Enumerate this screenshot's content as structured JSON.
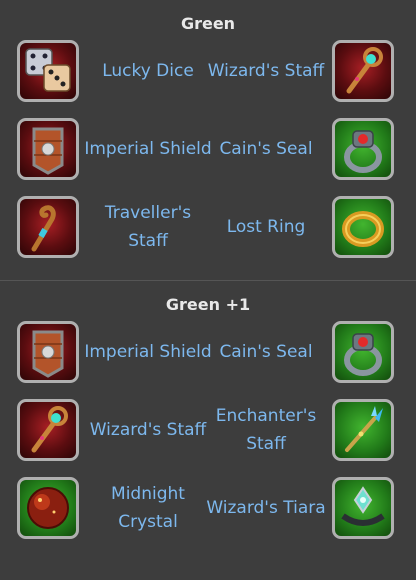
{
  "sections": [
    {
      "title": "Green",
      "rows": [
        {
          "left": {
            "name": "Lucky Dice",
            "icon": "dice-icon",
            "frame": "red"
          },
          "right": {
            "name": "Wizard's Staff",
            "icon": "wizard-staff-icon",
            "frame": "red"
          }
        },
        {
          "left": {
            "name": "Imperial Shield",
            "icon": "shield-icon",
            "frame": "red"
          },
          "right": {
            "name": "Cain's Seal",
            "icon": "ring-icon",
            "frame": "green"
          }
        },
        {
          "left": {
            "name": "Traveller's Staff",
            "icon": "traveller-staff-icon",
            "frame": "red"
          },
          "right": {
            "name": "Lost Ring",
            "icon": "gold-ring-icon",
            "frame": "green"
          }
        }
      ]
    },
    {
      "title": "Green +1",
      "rows": [
        {
          "left": {
            "name": "Imperial Shield",
            "icon": "shield-icon",
            "frame": "red"
          },
          "right": {
            "name": "Cain's Seal",
            "icon": "ring-icon",
            "frame": "green"
          }
        },
        {
          "left": {
            "name": "Wizard's Staff",
            "icon": "wizard-staff-icon",
            "frame": "red"
          },
          "right": {
            "name": "Enchanter's Staff",
            "icon": "enchanter-staff-icon",
            "frame": "green"
          }
        },
        {
          "left": {
            "name": "Midnight Crystal",
            "icon": "crystal-orb-icon",
            "frame": "green"
          },
          "right": {
            "name": "Wizard's Tiara",
            "icon": "tiara-icon",
            "frame": "green"
          }
        }
      ]
    }
  ],
  "colors": {
    "background": "#3d3d3d",
    "title": "#e9e9e9",
    "item_label": "#7db8ee",
    "red_frame": "#a81f24",
    "green_frame": "#42b52f"
  }
}
